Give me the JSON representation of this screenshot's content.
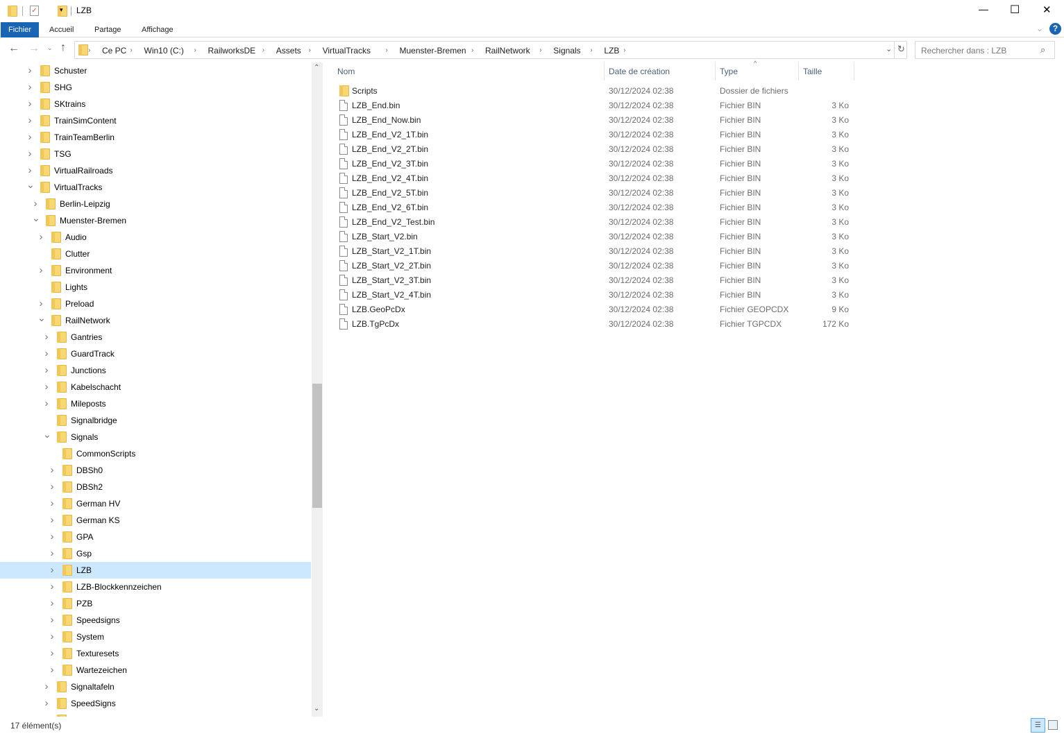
{
  "window": {
    "title": "LZB",
    "minimize": "—",
    "maximize": "☐",
    "close": "✕"
  },
  "ribbon": {
    "tabs": [
      "Fichier",
      "Accueil",
      "Partage",
      "Affichage"
    ],
    "help": "?",
    "expand": "⌄"
  },
  "address": {
    "crumbs": [
      "Ce PC",
      "Win10 (C:)",
      "RailworksDE",
      "Assets",
      "VirtualTracks",
      "Muenster-Bremen",
      "RailNetwork",
      "Signals",
      "LZB"
    ],
    "search_placeholder": "Rechercher dans : LZB"
  },
  "tree": [
    {
      "label": "Schuster",
      "level": 0,
      "state": "collapsed"
    },
    {
      "label": "SHG",
      "level": 0,
      "state": "collapsed"
    },
    {
      "label": "SKtrains",
      "level": 0,
      "state": "collapsed"
    },
    {
      "label": "TrainSimContent",
      "level": 0,
      "state": "collapsed"
    },
    {
      "label": "TrainTeamBerlin",
      "level": 0,
      "state": "collapsed"
    },
    {
      "label": "TSG",
      "level": 0,
      "state": "collapsed"
    },
    {
      "label": "VirtualRailroads",
      "level": 0,
      "state": "collapsed"
    },
    {
      "label": "VirtualTracks",
      "level": 0,
      "state": "expanded"
    },
    {
      "label": "Berlin-Leipzig",
      "level": 1,
      "state": "collapsed"
    },
    {
      "label": "Muenster-Bremen",
      "level": 1,
      "state": "expanded"
    },
    {
      "label": "Audio",
      "level": 2,
      "state": "collapsed"
    },
    {
      "label": "Clutter",
      "level": 2,
      "state": "none"
    },
    {
      "label": "Environment",
      "level": 2,
      "state": "collapsed"
    },
    {
      "label": "Lights",
      "level": 2,
      "state": "none"
    },
    {
      "label": "Preload",
      "level": 2,
      "state": "collapsed"
    },
    {
      "label": "RailNetwork",
      "level": 2,
      "state": "expanded"
    },
    {
      "label": "Gantries",
      "level": 3,
      "state": "collapsed"
    },
    {
      "label": "GuardTrack",
      "level": 3,
      "state": "collapsed"
    },
    {
      "label": "Junctions",
      "level": 3,
      "state": "collapsed"
    },
    {
      "label": "Kabelschacht",
      "level": 3,
      "state": "collapsed"
    },
    {
      "label": "Mileposts",
      "level": 3,
      "state": "collapsed"
    },
    {
      "label": "Signalbridge",
      "level": 3,
      "state": "none"
    },
    {
      "label": "Signals",
      "level": 3,
      "state": "expanded"
    },
    {
      "label": "CommonScripts",
      "level": 4,
      "state": "none"
    },
    {
      "label": "DBSh0",
      "level": 4,
      "state": "collapsed"
    },
    {
      "label": "DBSh2",
      "level": 4,
      "state": "collapsed"
    },
    {
      "label": "German HV",
      "level": 4,
      "state": "collapsed"
    },
    {
      "label": "German KS",
      "level": 4,
      "state": "collapsed"
    },
    {
      "label": "GPA",
      "level": 4,
      "state": "collapsed"
    },
    {
      "label": "Gsp",
      "level": 4,
      "state": "collapsed"
    },
    {
      "label": "LZB",
      "level": 4,
      "state": "collapsed",
      "selected": true
    },
    {
      "label": "LZB-Blockkennzeichen",
      "level": 4,
      "state": "collapsed"
    },
    {
      "label": "PZB",
      "level": 4,
      "state": "collapsed"
    },
    {
      "label": "Speedsigns",
      "level": 4,
      "state": "collapsed"
    },
    {
      "label": "System",
      "level": 4,
      "state": "collapsed"
    },
    {
      "label": "Texturesets",
      "level": 4,
      "state": "collapsed"
    },
    {
      "label": "Wartezeichen",
      "level": 4,
      "state": "collapsed"
    },
    {
      "label": "Signaltafeln",
      "level": 3,
      "state": "collapsed"
    },
    {
      "label": "SpeedSigns",
      "level": 3,
      "state": "collapsed"
    }
  ],
  "list": {
    "columns": [
      "Nom",
      "Date de création",
      "Type",
      "Taille"
    ],
    "rows": [
      {
        "name": "Scripts",
        "kind": "folder",
        "date": "30/12/2024 02:38",
        "type": "Dossier de fichiers",
        "size": ""
      },
      {
        "name": "LZB_End.bin",
        "kind": "file",
        "date": "30/12/2024 02:38",
        "type": "Fichier BIN",
        "size": "3 Ko"
      },
      {
        "name": "LZB_End_Now.bin",
        "kind": "file",
        "date": "30/12/2024 02:38",
        "type": "Fichier BIN",
        "size": "3 Ko"
      },
      {
        "name": "LZB_End_V2_1T.bin",
        "kind": "file",
        "date": "30/12/2024 02:38",
        "type": "Fichier BIN",
        "size": "3 Ko"
      },
      {
        "name": "LZB_End_V2_2T.bin",
        "kind": "file",
        "date": "30/12/2024 02:38",
        "type": "Fichier BIN",
        "size": "3 Ko"
      },
      {
        "name": "LZB_End_V2_3T.bin",
        "kind": "file",
        "date": "30/12/2024 02:38",
        "type": "Fichier BIN",
        "size": "3 Ko"
      },
      {
        "name": "LZB_End_V2_4T.bin",
        "kind": "file",
        "date": "30/12/2024 02:38",
        "type": "Fichier BIN",
        "size": "3 Ko"
      },
      {
        "name": "LZB_End_V2_5T.bin",
        "kind": "file",
        "date": "30/12/2024 02:38",
        "type": "Fichier BIN",
        "size": "3 Ko"
      },
      {
        "name": "LZB_End_V2_6T.bin",
        "kind": "file",
        "date": "30/12/2024 02:38",
        "type": "Fichier BIN",
        "size": "3 Ko"
      },
      {
        "name": "LZB_End_V2_Test.bin",
        "kind": "file",
        "date": "30/12/2024 02:38",
        "type": "Fichier BIN",
        "size": "3 Ko"
      },
      {
        "name": "LZB_Start_V2.bin",
        "kind": "file",
        "date": "30/12/2024 02:38",
        "type": "Fichier BIN",
        "size": "3 Ko"
      },
      {
        "name": "LZB_Start_V2_1T.bin",
        "kind": "file",
        "date": "30/12/2024 02:38",
        "type": "Fichier BIN",
        "size": "3 Ko"
      },
      {
        "name": "LZB_Start_V2_2T.bin",
        "kind": "file",
        "date": "30/12/2024 02:38",
        "type": "Fichier BIN",
        "size": "3 Ko"
      },
      {
        "name": "LZB_Start_V2_3T.bin",
        "kind": "file",
        "date": "30/12/2024 02:38",
        "type": "Fichier BIN",
        "size": "3 Ko"
      },
      {
        "name": "LZB_Start_V2_4T.bin",
        "kind": "file",
        "date": "30/12/2024 02:38",
        "type": "Fichier BIN",
        "size": "3 Ko"
      },
      {
        "name": "LZB.GeoPcDx",
        "kind": "file",
        "date": "30/12/2024 02:38",
        "type": "Fichier GEOPCDX",
        "size": "9 Ko"
      },
      {
        "name": "LZB.TgPcDx",
        "kind": "file",
        "date": "30/12/2024 02:38",
        "type": "Fichier TGPCDX",
        "size": "172 Ko"
      }
    ]
  },
  "status": {
    "count": "17 élément(s)"
  },
  "colors": {
    "accent": "#1a64b4",
    "selection": "#cce8ff"
  }
}
